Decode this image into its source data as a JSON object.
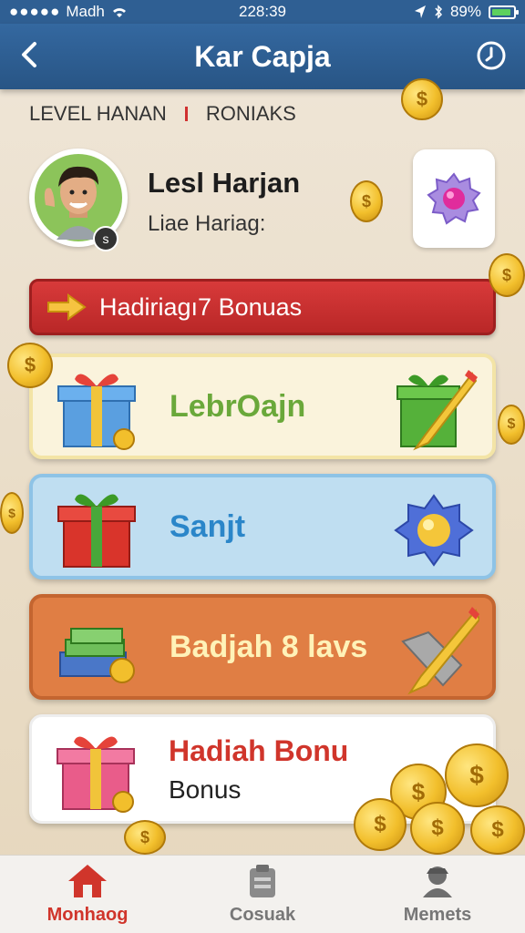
{
  "status_bar": {
    "carrier": "Madh",
    "time": "228:39",
    "battery": "89%",
    "battery_level": 0.89
  },
  "header": {
    "title": "Kar Capja"
  },
  "top_tabs": [
    "LEVEL HANAN",
    "RONIAKS"
  ],
  "profile": {
    "name": "Lesl Harjan",
    "subtitle": "Liae Hariag:",
    "badge": "s"
  },
  "banner": {
    "label": "Hadiriagı7 Bonuas"
  },
  "cards": [
    {
      "label": "LebrOajn"
    },
    {
      "label": "Sanjt"
    },
    {
      "label": "Badjah 8 lavs"
    },
    {
      "label": "Hadiah Bonu",
      "sub": "Bonus"
    }
  ],
  "bottom_nav": [
    {
      "label": "Monhaog",
      "icon": "home-icon",
      "active": true
    },
    {
      "label": "Cosuak",
      "icon": "clipboard-icon",
      "active": false
    },
    {
      "label": "Memets",
      "icon": "person-icon",
      "active": false
    }
  ],
  "colors": {
    "header": "#2f5f93",
    "banner": "#c93131",
    "active_nav": "#d0352b"
  }
}
